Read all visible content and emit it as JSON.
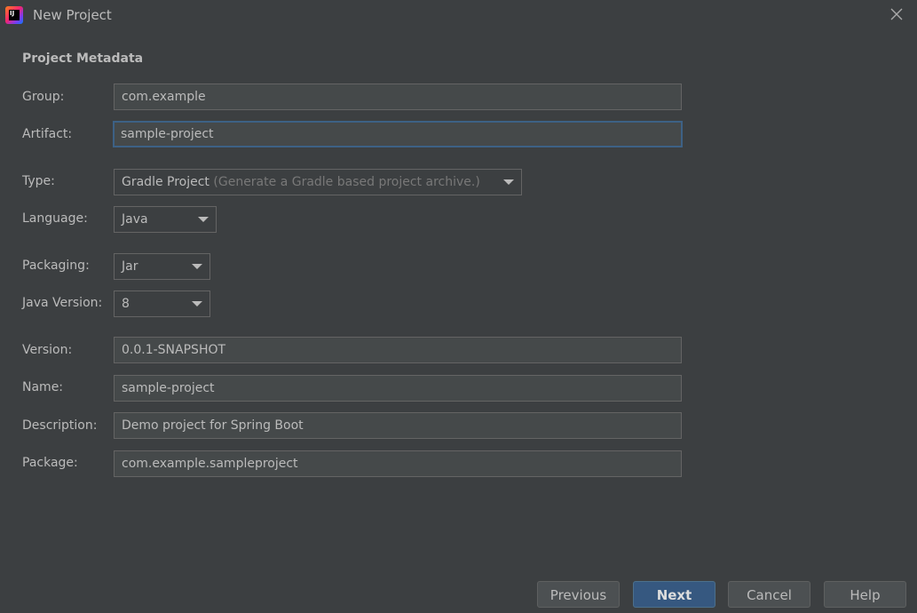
{
  "window": {
    "title": "New Project",
    "logo_text": "IJ"
  },
  "section_title": "Project Metadata",
  "fields": {
    "group": {
      "label": "Group:",
      "value": "com.example"
    },
    "artifact": {
      "label": "Artifact:",
      "value": "sample-project"
    },
    "type": {
      "label": "Type:",
      "value": "Gradle Project",
      "hint": "(Generate a Gradle based project archive.)"
    },
    "language": {
      "label": "Language:",
      "value": "Java"
    },
    "packaging": {
      "label": "Packaging:",
      "value": "Jar"
    },
    "java_version": {
      "label": "Java Version:",
      "value": "8"
    },
    "version": {
      "label": "Version:",
      "value": "0.0.1-SNAPSHOT"
    },
    "name": {
      "label": "Name:",
      "value": "sample-project"
    },
    "description": {
      "label": "Description:",
      "value": "Demo project for Spring Boot"
    },
    "package": {
      "label": "Package:",
      "value": "com.example.sampleproject"
    }
  },
  "buttons": {
    "previous": "Previous",
    "next": "Next",
    "cancel": "Cancel",
    "help": "Help"
  },
  "colors": {
    "background": "#3c3f41",
    "field_background": "#45494a",
    "focus_border": "#3d6185",
    "primary_button": "#365880"
  }
}
